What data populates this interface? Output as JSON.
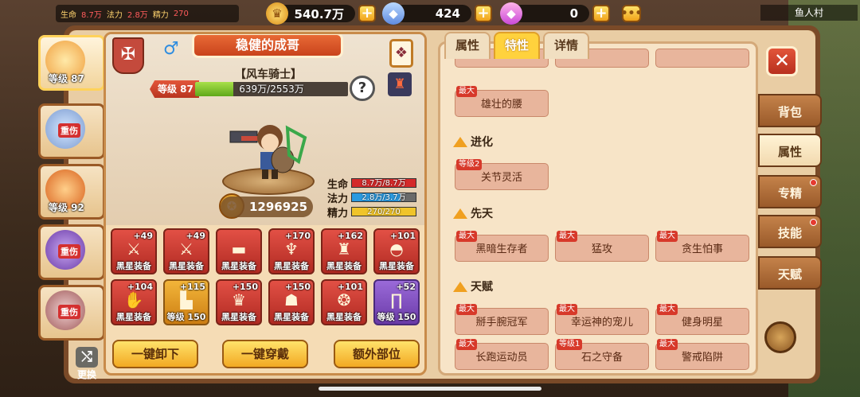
{
  "topbar": {
    "hp_label": "生命",
    "hp_value": "8.7万",
    "mp_label": "法力",
    "mp_value": "2.8万",
    "sp_label": "精力",
    "sp_value": "270",
    "gold": "540.7万",
    "diamonds": "424",
    "premium": "0",
    "map_name": "鱼人村"
  },
  "roster": [
    {
      "level": "等级 87",
      "active": true,
      "hurt": ""
    },
    {
      "level": "",
      "active": false,
      "hurt": "重伤"
    },
    {
      "level": "等级 92",
      "active": false,
      "hurt": ""
    },
    {
      "level": "",
      "active": false,
      "hurt": "重伤"
    },
    {
      "level": "",
      "active": false,
      "hurt": "重伤"
    }
  ],
  "swap_label": "更换",
  "hero": {
    "name": "稳健的成哥",
    "class": "【风车骑士】",
    "level": "等级 87",
    "xp": "639万/2553万",
    "xp_fraction": 0.25,
    "power": "1296925",
    "stats": [
      {
        "label": "生命",
        "value": "8.7万/8.7万",
        "fraction": 1.0,
        "color": "#d42a2a"
      },
      {
        "label": "法力",
        "value": "2.8万/3.7万",
        "fraction": 0.76,
        "color": "#2a9ae0"
      },
      {
        "label": "精力",
        "value": "270/270",
        "fraction": 1.0,
        "color": "#f0c42a"
      }
    ]
  },
  "equipment": [
    {
      "plus": "+49",
      "tag": "黑星装备",
      "kind": "red",
      "icon": "sword-icon",
      "glyph": "⚔"
    },
    {
      "plus": "+49",
      "tag": "黑星装备",
      "kind": "red",
      "icon": "sword-icon",
      "glyph": "⚔"
    },
    {
      "plus": "",
      "tag": "黑星装备",
      "kind": "red",
      "icon": "cannon-icon",
      "glyph": "▬"
    },
    {
      "plus": "+170",
      "tag": "黑星装备",
      "kind": "red",
      "icon": "horn-icon",
      "glyph": "♆"
    },
    {
      "plus": "+162",
      "tag": "黑星装备",
      "kind": "red",
      "icon": "chest-armor-icon",
      "glyph": "♜"
    },
    {
      "plus": "+101",
      "tag": "黑星装备",
      "kind": "red",
      "icon": "helmet-icon",
      "glyph": "◓"
    },
    {
      "plus": "+104",
      "tag": "黑星装备",
      "kind": "red",
      "icon": "glove-icon",
      "glyph": "✋"
    },
    {
      "plus": "+115",
      "tag": "等级 150",
      "kind": "gold",
      "icon": "boot-icon",
      "glyph": "▙"
    },
    {
      "plus": "+150",
      "tag": "黑星装备",
      "kind": "red",
      "icon": "demon-armor-icon",
      "glyph": "♛"
    },
    {
      "plus": "+150",
      "tag": "黑星装备",
      "kind": "red",
      "icon": "demon-mask-icon",
      "glyph": "☗"
    },
    {
      "plus": "+101",
      "tag": "黑星装备",
      "kind": "red",
      "icon": "necklace-icon",
      "glyph": "❂"
    },
    {
      "plus": "+52",
      "tag": "等级 150",
      "kind": "purple",
      "icon": "cape-icon",
      "glyph": "∏"
    }
  ],
  "actions": {
    "unequip_all": "一键卸下",
    "equip_all": "一键穿戴",
    "extra_slots": "额外部位"
  },
  "tabs": [
    "属性",
    "特性",
    "详情"
  ],
  "active_tab": 1,
  "traits": {
    "top_partial": [
      "",
      "",
      ""
    ],
    "first": {
      "badge": "最大",
      "name": "雄壮的腰"
    },
    "evolution_title": "进化",
    "evolution": [
      {
        "badge": "等级2",
        "name": "关节灵活"
      }
    ],
    "innate_title": "先天",
    "innate": [
      {
        "badge": "最大",
        "name": "黑暗生存者"
      },
      {
        "badge": "最大",
        "name": "猛攻"
      },
      {
        "badge": "最大",
        "name": "贪生怕事"
      }
    ],
    "talent_title": "天赋",
    "talent": [
      {
        "badge": "最大",
        "name": "掰手腕冠军"
      },
      {
        "badge": "最大",
        "name": "幸运神的宠儿"
      },
      {
        "badge": "最大",
        "name": "健身明星"
      }
    ],
    "talent_row2": [
      {
        "badge": "最大",
        "name": "长跑运动员"
      },
      {
        "badge": "等级1",
        "name": "石之守备"
      },
      {
        "badge": "最大",
        "name": "警戒陷阱"
      }
    ]
  },
  "side_tabs": [
    {
      "label": "背包",
      "active": false,
      "dot": false
    },
    {
      "label": "属性",
      "active": true,
      "dot": false
    },
    {
      "label": "专精",
      "active": false,
      "dot": true
    },
    {
      "label": "技能",
      "active": false,
      "dot": true
    },
    {
      "label": "天赋",
      "active": false,
      "dot": false
    }
  ],
  "colors": {
    "accent": "#ffd23d",
    "trait_bg": "#e8b59c",
    "badge": "#d7392a"
  }
}
